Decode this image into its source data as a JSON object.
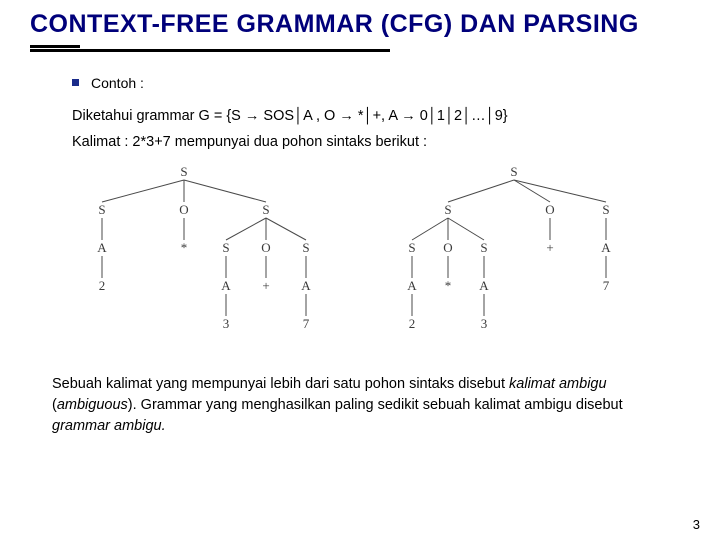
{
  "title": "CONTEXT-FREE GRAMMAR (CFG) DAN PARSING",
  "bullet_label": "Contoh :",
  "line_grammar_prefix": "Diketahui grammar G = {S ",
  "arrow": "→",
  "bar": "│",
  "g_part1": " SOS",
  "g_part2": "A ,  O ",
  "g_part3": " *",
  "g_part4": "+, A ",
  "g_part5": " 0",
  "g_part6": "1",
  "g_part7": "2",
  "g_ellipsis": "…",
  "g_last": "9}",
  "line_sentence": "Kalimat : 2*3+7 mempunyai dua pohon sintaks berikut  :",
  "tree1": {
    "top": "S",
    "l1": [
      "S",
      "O",
      "S"
    ],
    "left_l2": [
      "A",
      "*",
      "S",
      "O",
      "S"
    ],
    "left_l3": [
      "2",
      "A",
      "+",
      "A"
    ],
    "left_l4": [
      "3",
      "7"
    ]
  },
  "tree2": {
    "top": "S",
    "l1": [
      "S",
      "O",
      "S"
    ],
    "r_l2": [
      "S",
      "O",
      "S",
      "+",
      "A"
    ],
    "r_l3": [
      "A",
      "*",
      "A",
      "7"
    ],
    "r_l4": [
      "2",
      "3"
    ]
  },
  "footer_part1": "Sebuah kalimat yang mempunyai lebih dari satu pohon sintaks disebut ",
  "footer_italic1": "kalimat ambigu",
  "footer_paren_open": " (",
  "footer_italic2": "ambiguous",
  "footer_part2": "). Grammar yang menghasilkan paling sedikit sebuah kalimat ambigu disebut ",
  "footer_italic3": "grammar ambigu.",
  "page": "3"
}
